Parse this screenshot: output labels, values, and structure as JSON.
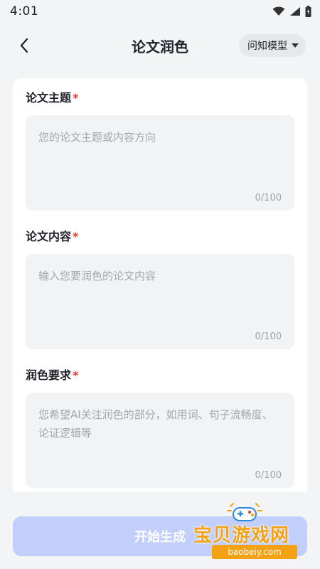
{
  "status_bar": {
    "time": "4:01"
  },
  "header": {
    "title": "论文润色",
    "model_selector": "问知模型"
  },
  "form": {
    "fields": [
      {
        "label": "论文主题",
        "required_mark": "*",
        "placeholder": "您的论文主题或内容方向",
        "counter": "0/100"
      },
      {
        "label": "论文内容",
        "required_mark": "*",
        "placeholder": "输入您要润色的论文内容",
        "counter": "0/100"
      },
      {
        "label": "润色要求",
        "required_mark": "*",
        "placeholder": "您希望AI关注润色的部分，如用词、句子流畅度、论证逻辑等",
        "counter": "0/100"
      }
    ]
  },
  "actions": {
    "start_label": "开始生成"
  },
  "watermark": {
    "title": "宝贝游戏网",
    "domain": "baobeiy.com"
  },
  "colors": {
    "background": "#f3f4f6",
    "button": "#c2cffb",
    "required": "#e53935",
    "watermark": "#f4a214"
  }
}
